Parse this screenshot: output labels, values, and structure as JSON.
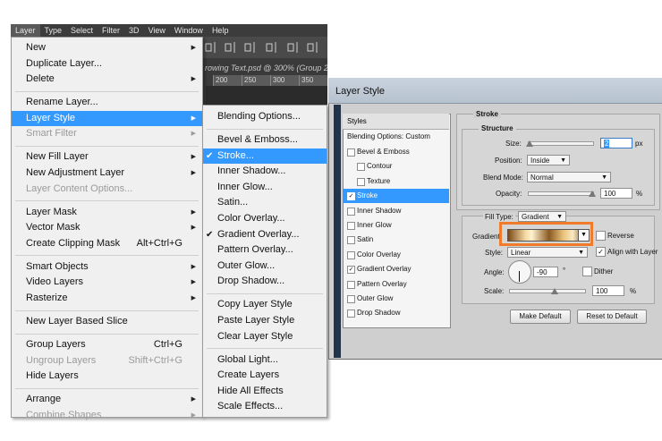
{
  "menubar": [
    "Layer",
    "Type",
    "Select",
    "Filter",
    "3D",
    "View",
    "Window",
    "Help"
  ],
  "doc_title": "rowing Text.psd @ 300% (Group 2",
  "ruler_ticks": [
    "200",
    "250",
    "300",
    "350"
  ],
  "layer_menu": [
    {
      "label": "New",
      "submenu": true
    },
    {
      "label": "Duplicate Layer..."
    },
    {
      "label": "Delete",
      "submenu": true
    },
    {
      "sep": true
    },
    {
      "label": "Rename Layer..."
    },
    {
      "label": "Layer Style",
      "submenu": true,
      "highlight": true
    },
    {
      "label": "Smart Filter",
      "submenu": true,
      "disabled": true
    },
    {
      "sep": true
    },
    {
      "label": "New Fill Layer",
      "submenu": true
    },
    {
      "label": "New Adjustment Layer",
      "submenu": true
    },
    {
      "label": "Layer Content Options...",
      "disabled": true
    },
    {
      "sep": true
    },
    {
      "label": "Layer Mask",
      "submenu": true
    },
    {
      "label": "Vector Mask",
      "submenu": true
    },
    {
      "label": "Create Clipping Mask",
      "shortcut": "Alt+Ctrl+G"
    },
    {
      "sep": true
    },
    {
      "label": "Smart Objects",
      "submenu": true
    },
    {
      "label": "Video Layers",
      "submenu": true
    },
    {
      "label": "Rasterize",
      "submenu": true
    },
    {
      "sep": true
    },
    {
      "label": "New Layer Based Slice"
    },
    {
      "sep": true
    },
    {
      "label": "Group Layers",
      "shortcut": "Ctrl+G"
    },
    {
      "label": "Ungroup Layers",
      "shortcut": "Shift+Ctrl+G",
      "disabled": true
    },
    {
      "label": "Hide Layers"
    },
    {
      "sep": true
    },
    {
      "label": "Arrange",
      "submenu": true
    },
    {
      "label": "Combine Shapes",
      "submenu": true,
      "disabled": true
    }
  ],
  "style_submenu": [
    {
      "label": "Blending Options..."
    },
    {
      "sep": true
    },
    {
      "label": "Bevel & Emboss..."
    },
    {
      "label": "Stroke...",
      "checked": true,
      "highlight": true
    },
    {
      "label": "Inner Shadow..."
    },
    {
      "label": "Inner Glow..."
    },
    {
      "label": "Satin..."
    },
    {
      "label": "Color Overlay..."
    },
    {
      "label": "Gradient Overlay...",
      "checked": true
    },
    {
      "label": "Pattern Overlay..."
    },
    {
      "label": "Outer Glow..."
    },
    {
      "label": "Drop Shadow..."
    },
    {
      "sep": true
    },
    {
      "label": "Copy Layer Style"
    },
    {
      "label": "Paste Layer Style"
    },
    {
      "label": "Clear Layer Style"
    },
    {
      "sep": true
    },
    {
      "label": "Global Light..."
    },
    {
      "label": "Create Layers"
    },
    {
      "label": "Hide All Effects"
    },
    {
      "label": "Scale Effects..."
    }
  ],
  "dialog": {
    "title": "Layer Style",
    "styles_header": "Styles",
    "styles": [
      {
        "label": "Blending Options: Custom",
        "header": true
      },
      {
        "label": "Bevel & Emboss",
        "checked": false
      },
      {
        "label": "Contour",
        "checked": false,
        "sub": true
      },
      {
        "label": "Texture",
        "checked": false,
        "sub": true
      },
      {
        "label": "Stroke",
        "checked": true,
        "selected": true
      },
      {
        "label": "Inner Shadow",
        "checked": false
      },
      {
        "label": "Inner Glow",
        "checked": false
      },
      {
        "label": "Satin",
        "checked": false
      },
      {
        "label": "Color Overlay",
        "checked": false
      },
      {
        "label": "Gradient Overlay",
        "checked": true
      },
      {
        "label": "Pattern Overlay",
        "checked": false
      },
      {
        "label": "Outer Glow",
        "checked": false
      },
      {
        "label": "Drop Shadow",
        "checked": false
      }
    ],
    "stroke_title": "Stroke",
    "structure_title": "Structure",
    "size_label": "Size:",
    "size_value": "2",
    "size_unit": "px",
    "position_label": "Position:",
    "position_value": "Inside",
    "blend_label": "Blend Mode:",
    "blend_value": "Normal",
    "opacity_label": "Opacity:",
    "opacity_value": "100",
    "opacity_unit": "%",
    "filltype_label": "Fill Type:",
    "filltype_value": "Gradient",
    "gradient_label": "Gradient:",
    "reverse_label": "Reverse",
    "reverse_checked": false,
    "style_label": "Style:",
    "style_value": "Linear",
    "align_label": "Align with Layer",
    "align_checked": true,
    "angle_label": "Angle:",
    "angle_value": "-90",
    "angle_unit": "°",
    "dither_label": "Dither",
    "dither_checked": false,
    "scale_label": "Scale:",
    "scale_value": "100",
    "scale_unit": "%",
    "make_default": "Make Default",
    "reset_default": "Reset to Default"
  },
  "colors": {
    "highlight": "#3399ff",
    "annotation": "#f07b2a",
    "app_dark": "#3a3a3a"
  }
}
